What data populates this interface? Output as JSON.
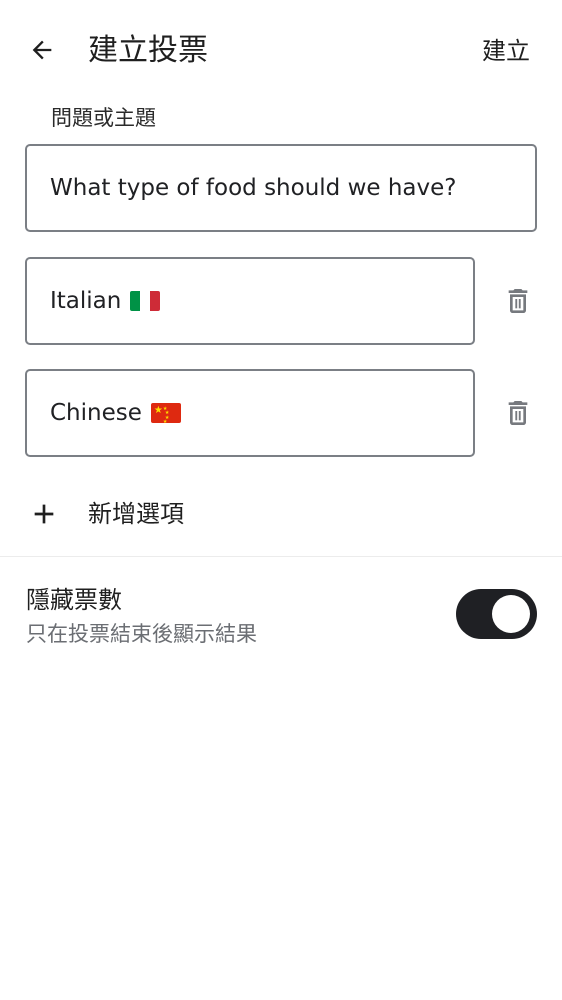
{
  "app_bar": {
    "title": "建立投票",
    "create_label": "建立"
  },
  "question": {
    "label": "問題或主題",
    "value": "What type of food should we have?"
  },
  "options": [
    {
      "value": "Italian",
      "flag": "flag-italy-icon"
    },
    {
      "value": "Chinese",
      "flag": "flag-china-icon"
    }
  ],
  "add_option": {
    "label": "新增選項"
  },
  "hide_votes": {
    "title": "隱藏票數",
    "subtitle": "只在投票結束後顯示結果",
    "enabled": true
  },
  "colors": {
    "toggle_on": "#1f2024",
    "field_border": "#7b7f85",
    "secondary_text": "#6b6e73"
  }
}
